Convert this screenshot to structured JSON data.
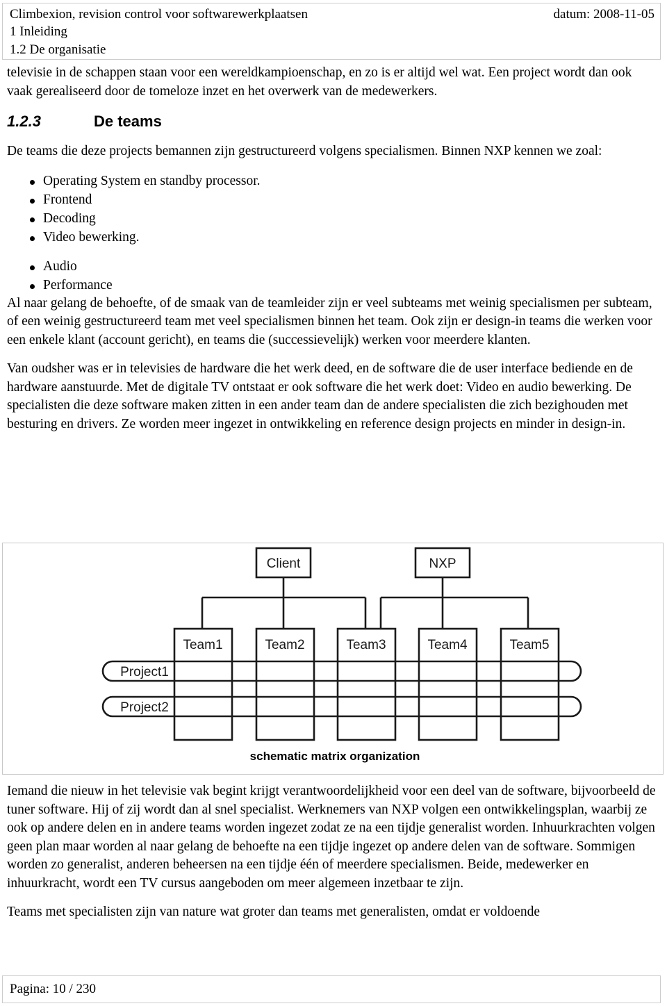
{
  "header": {
    "title": "Climbexion, revision control voor softwarewerkplaatsen",
    "date": "datum: 2008-11-05",
    "chapter": "1 Inleiding",
    "section": "1.2 De organisatie"
  },
  "body": {
    "intro_paragraph": "televisie in de schappen staan voor een wereldkampioenschap, en zo is er altijd wel wat. Een project wordt dan ook vaak gerealiseerd door de tomeloze inzet en het overwerk van de medewerkers.",
    "heading_number": "1.2.3",
    "heading_text": "De teams",
    "list_intro": "De teams die deze projects bemannen zijn gestructureerd volgens specialismen. Binnen NXP kennen we zoal:",
    "specialisms": [
      "Operating System en standby processor.",
      "Frontend",
      "Decoding",
      "Video bewerking.",
      "Audio",
      "Performance"
    ],
    "paragraph_2": "Al naar gelang de behoefte, of de smaak van de teamleider zijn er veel subteams met weinig specialismen per subteam, of een weinig gestructureerd team met veel specialismen binnen het team. Ook zijn er design-in teams die werken voor een enkele klant (account gericht), en teams die (successievelijk) werken voor meerdere klanten.",
    "paragraph_3": "Van oudsher was er in televisies de hardware die het werk deed, en de software die de user interface bediende en de hardware aanstuurde. Met de digitale TV ontstaat er ook software die het werk doet: Video en audio bewerking. De specialisten die deze software maken zitten in een ander team dan de andere specialisten die zich bezighouden met besturing en drivers. Ze worden meer ingezet in ontwikkeling en reference design projects en minder in design-in.",
    "paragraph_4": "Iemand die nieuw in het televisie vak begint krijgt verantwoordelijkheid voor een deel van de software, bijvoorbeeld de tuner software. Hij of zij wordt dan al snel specialist. Werknemers van NXP volgen een ontwikkelingsplan, waarbij ze ook op andere delen en in andere teams worden ingezet zodat ze na een tijdje generalist worden. Inhuurkrachten volgen geen plan maar worden al naar gelang de behoefte na een tijdje ingezet op andere delen van de software. Sommigen worden zo generalist, anderen beheersen na een tijdje één of meerdere specialismen. Beide, medewerker en inhuurkracht,  wordt  een TV cursus aangeboden om meer algemeen inzetbaar te zijn.",
    "paragraph_5": "Teams met specialisten zijn van nature wat groter dan teams met generalisten, omdat er voldoende"
  },
  "figure": {
    "caption": "schematic matrix organization",
    "top_nodes": [
      {
        "label": "Client"
      },
      {
        "label": "NXP"
      }
    ],
    "team_nodes": [
      {
        "label": "Team1"
      },
      {
        "label": "Team2"
      },
      {
        "label": "Team3"
      },
      {
        "label": "Team4"
      },
      {
        "label": "Team5"
      }
    ],
    "project_nodes": [
      {
        "label": "Project1"
      },
      {
        "label": "Project2"
      }
    ],
    "client_connects_to": [
      "Team1",
      "Team2",
      "Team3"
    ],
    "nxp_connects_to": [
      "Team3",
      "Team4",
      "Team5"
    ]
  },
  "footer": {
    "page_label": "Pagina: 10 / 230"
  }
}
